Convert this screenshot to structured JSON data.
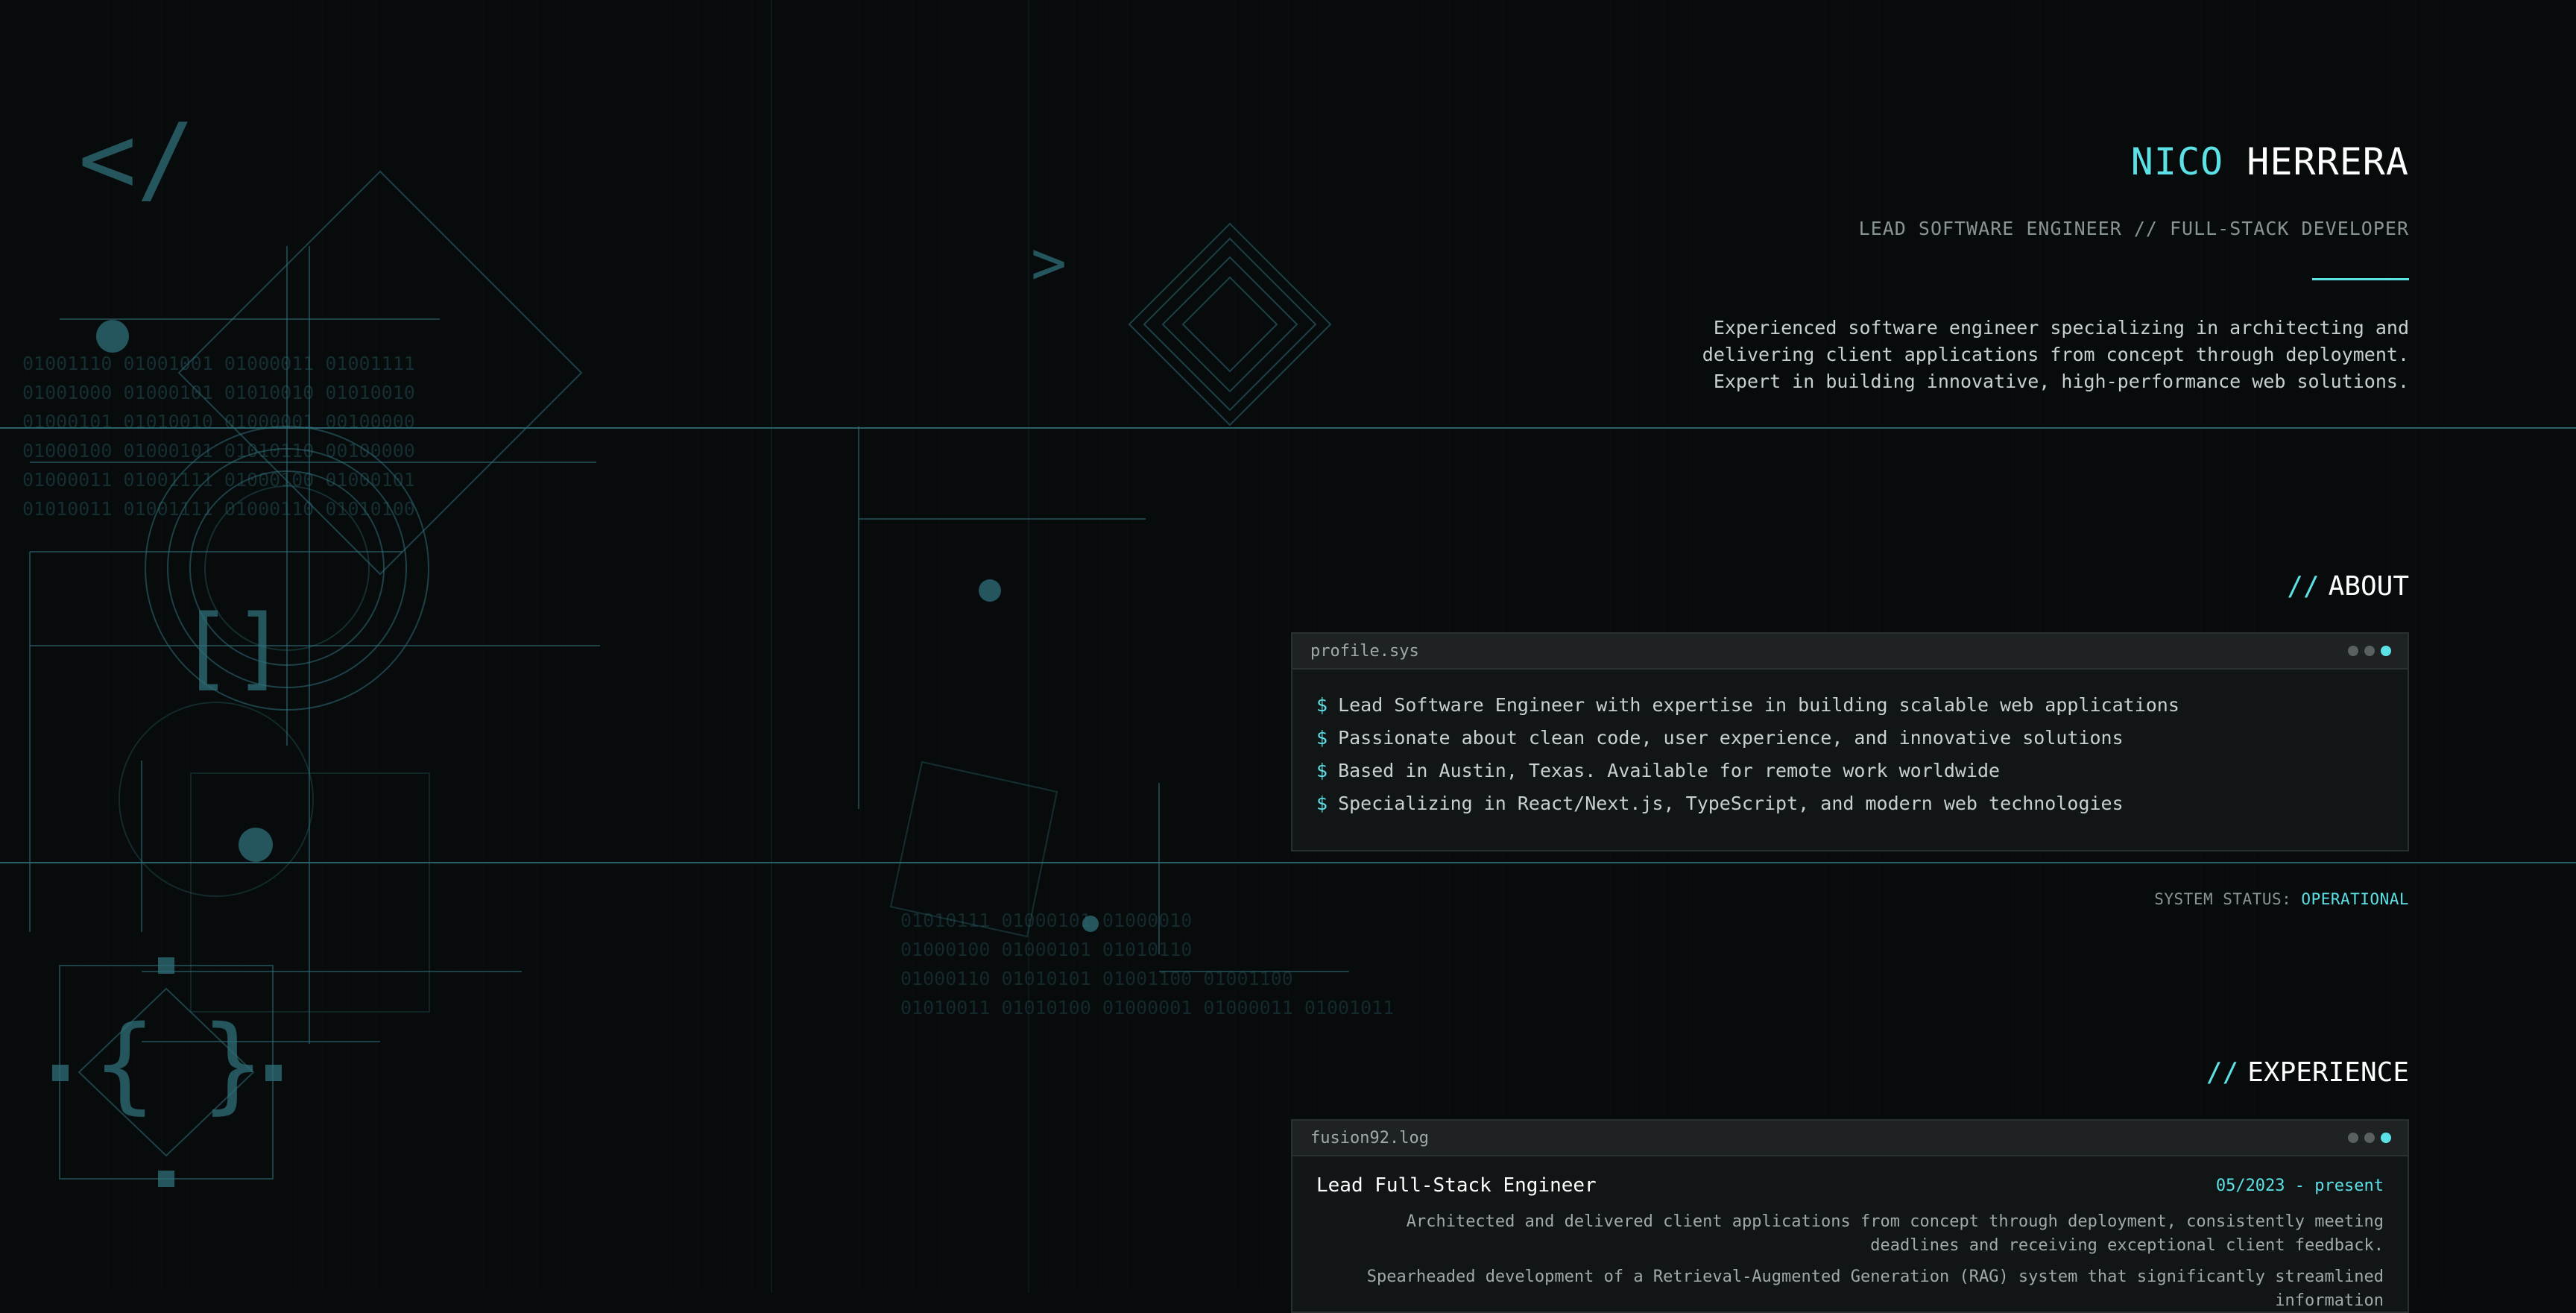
{
  "header": {
    "first_name": "NICO",
    "last_name": "HERRERA",
    "subtitle": "LEAD SOFTWARE ENGINEER // FULL-STACK DEVELOPER",
    "summary": "Experienced software engineer specializing in architecting and delivering client applications from concept through deployment. Expert in building innovative, high-performance web solutions."
  },
  "about": {
    "slashes": "//",
    "title": "ABOUT",
    "window_name": "profile.sys",
    "prompt": "$",
    "lines": [
      "Lead Software Engineer with expertise in building scalable web applications",
      "Passionate about clean code, user experience, and innovative solutions",
      "Based in Austin, Texas. Available for remote work worldwide",
      "Specializing in React/Next.js, TypeScript, and modern web technologies"
    ]
  },
  "status": {
    "label": "SYSTEM STATUS:",
    "value": "OPERATIONAL"
  },
  "experience": {
    "slashes": "//",
    "title": "EXPERIENCE",
    "window_name": "fusion92.log",
    "job_title": "Lead Full-Stack Engineer",
    "dates": "05/2023 - present",
    "desc_1": "Architected and delivered client applications from concept through deployment, consistently meeting deadlines and receiving exceptional client feedback.",
    "desc_2": "Spearheaded development of a Retrieval-Augmented Generation (RAG) system that significantly streamlined information"
  },
  "decor": {
    "code_close": "</",
    "chevron": ">",
    "brackets": "[]",
    "braces_open": "{",
    "braces_close": "}",
    "binary_block_1": [
      "01001110 01001001 01000011 01001111",
      "01001000 01000101 01010010 01010010",
      "01000101 01010010 01000001 00100000",
      "01000100 01000101 01010110 00100000",
      "01000011 01001111 01000100 01000101",
      "01010011 01001111 01000110 01010100"
    ],
    "binary_block_2": [
      "01010111 01000101 01000010",
      "01000100 01000101 01010110",
      "01000110 01010101 01001100 01001100",
      "01010011 01010100 01000001 01000011 01001011"
    ]
  },
  "colors": {
    "accent": "#5ce1e6",
    "background": "#080b0c",
    "decor": "#2f6f78"
  }
}
